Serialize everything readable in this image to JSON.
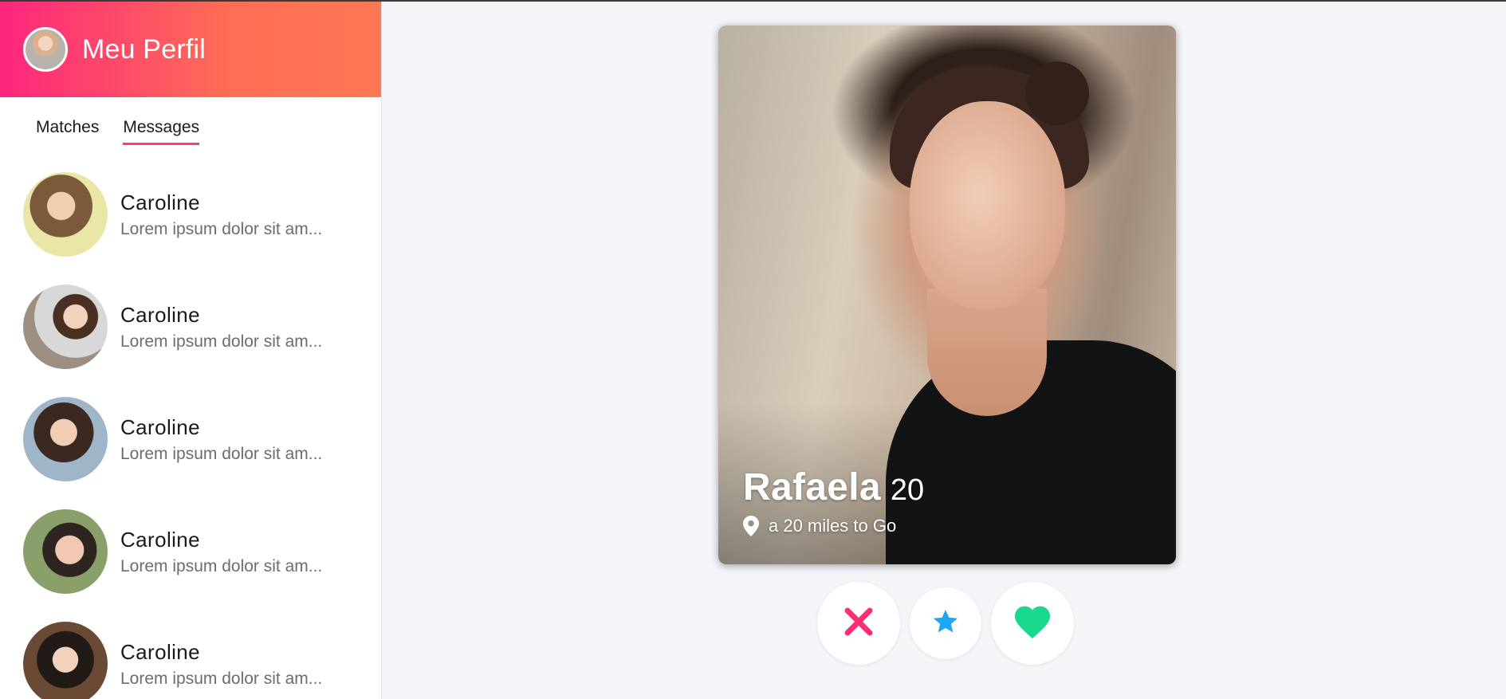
{
  "profile": {
    "title": "Meu Perfil",
    "avatar_icon": "user-avatar"
  },
  "tabs": [
    {
      "label": "Matches",
      "active": false
    },
    {
      "label": "Messages",
      "active": true
    }
  ],
  "conversations": [
    {
      "name": "Caroline",
      "preview": "Lorem ipsum dolor sit am..."
    },
    {
      "name": "Caroline",
      "preview": "Lorem ipsum dolor sit am..."
    },
    {
      "name": "Caroline",
      "preview": "Lorem ipsum dolor sit am..."
    },
    {
      "name": "Caroline",
      "preview": "Lorem ipsum dolor sit am..."
    },
    {
      "name": "Caroline",
      "preview": "Lorem ipsum dolor sit am..."
    }
  ],
  "card": {
    "name": "Rafaela",
    "age": "20",
    "distance": "a 20 miles to Go",
    "location_icon": "map-pin-icon"
  },
  "actions": [
    {
      "name": "dislike",
      "icon": "close-icon",
      "color": "#fd2f74"
    },
    {
      "name": "super-like",
      "icon": "star-icon",
      "color": "#1da6f5"
    },
    {
      "name": "like",
      "icon": "heart-icon",
      "color": "#18d98e"
    }
  ],
  "colors": {
    "gradient_start": "#fd267d",
    "gradient_end": "#ff7854",
    "tab_underline": "#fd3f64"
  }
}
